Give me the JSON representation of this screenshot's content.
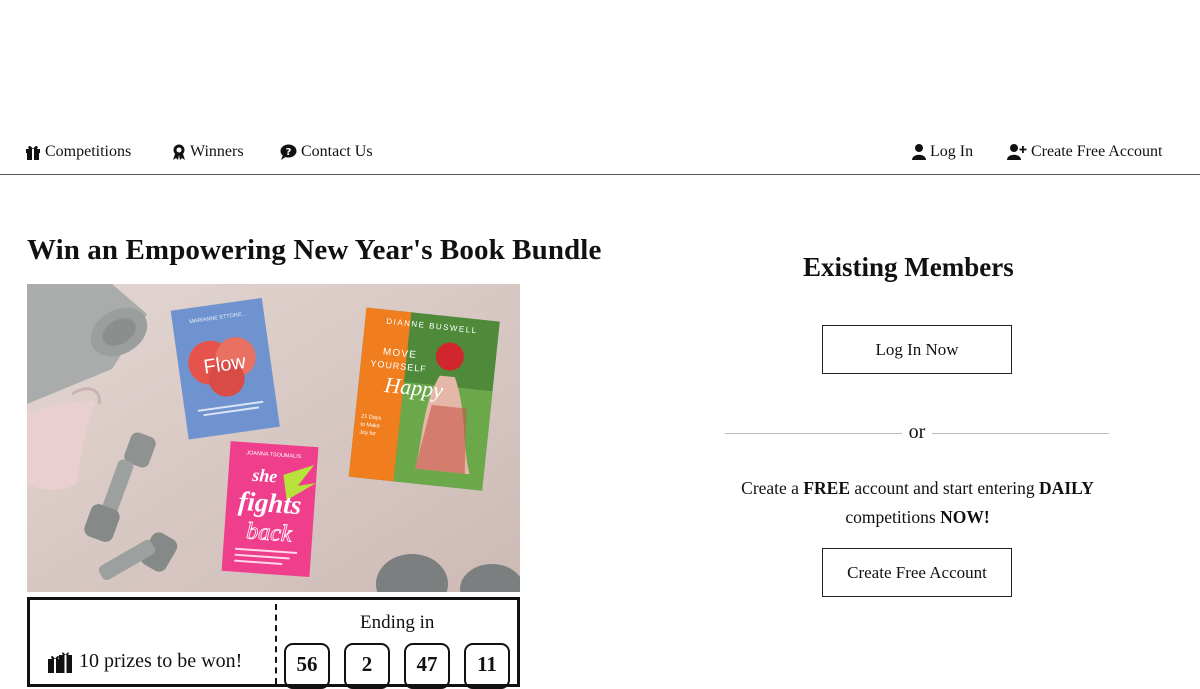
{
  "nav": {
    "competitions": "Competitions",
    "winners": "Winners",
    "contact": "Contact Us",
    "login": "Log In",
    "create": "Create Free Account"
  },
  "competition": {
    "title": "Win an Empowering New Year's Book Bundle",
    "prizes_text": "10 prizes to be won!",
    "ending_label": "Ending in",
    "countdown": [
      "56",
      "2",
      "47",
      "11"
    ],
    "books": {
      "flow": {
        "author": "MARIANNE ETTORE…",
        "title": "Flow"
      },
      "move": {
        "author": "DIANNE BUSWELL",
        "line1": "MOVE",
        "line2": "YOURSELF",
        "line3": "Happy",
        "blurb": "21 Days to Make Joy for Movement a Habit"
      },
      "fights": {
        "author": "JOANNA TSOUMALIS",
        "line1": "she",
        "line2": "fights",
        "line3": "back",
        "blurb": "Using Self-Defence Psychology to Reclaim Your Power"
      }
    }
  },
  "members": {
    "heading": "Existing Members",
    "login_button": "Log In Now",
    "or": "or",
    "promo_1": "Create a ",
    "promo_free": "FREE",
    "promo_2": " account and start entering ",
    "promo_daily": "DAILY",
    "promo_3": " competitions ",
    "promo_now": "NOW!",
    "create_button": "Create Free Account"
  },
  "colors": {
    "accent": "#111111",
    "hero_bg": "#d8c9c4",
    "flow_blue": "#6f93cf",
    "move_orange": "#f07d1e",
    "fights_pink": "#ef3f8c"
  }
}
